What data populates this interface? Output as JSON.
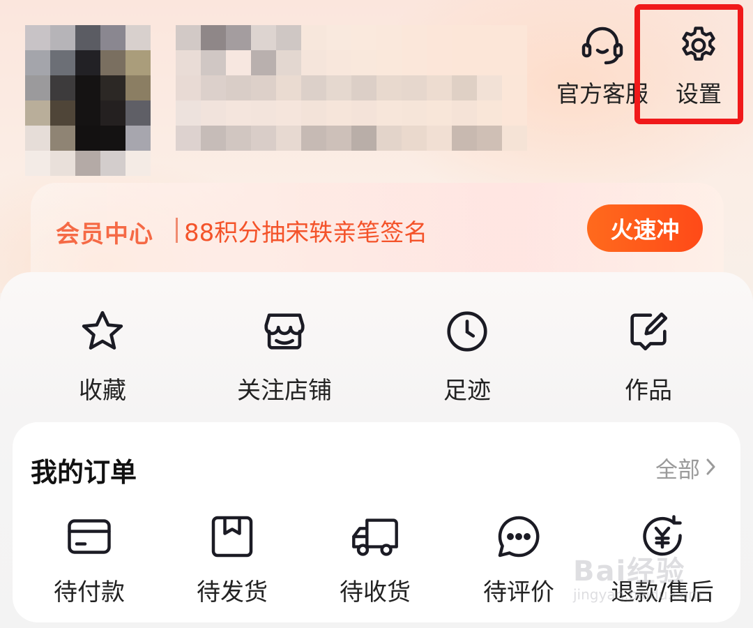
{
  "header": {
    "service": {
      "label": "官方客服",
      "icon": "headset-icon"
    },
    "settings": {
      "label": "设置",
      "icon": "gear-icon"
    },
    "highlight_color": "#f0191a"
  },
  "member_banner": {
    "title": "会员中心",
    "promo": "88积分抽宋轶亲笔签名",
    "cta": "火速冲",
    "accent_color": "#f4532a"
  },
  "shortcuts": [
    {
      "label": "收藏",
      "icon": "star-icon"
    },
    {
      "label": "关注店铺",
      "icon": "store-icon"
    },
    {
      "label": "足迹",
      "icon": "clock-icon"
    },
    {
      "label": "作品",
      "icon": "edit-note-icon"
    }
  ],
  "orders": {
    "title": "我的订单",
    "all_label": "全部",
    "items": [
      {
        "label": "待付款",
        "icon": "card-icon"
      },
      {
        "label": "待发货",
        "icon": "box-icon"
      },
      {
        "label": "待收货",
        "icon": "truck-icon"
      },
      {
        "label": "待评价",
        "icon": "chat-bubble-icon"
      },
      {
        "label": "退款/售后",
        "icon": "refund-yen-icon"
      }
    ]
  },
  "watermark": {
    "main": "Bai经验",
    "sub": "jingyan.baidu.com"
  }
}
